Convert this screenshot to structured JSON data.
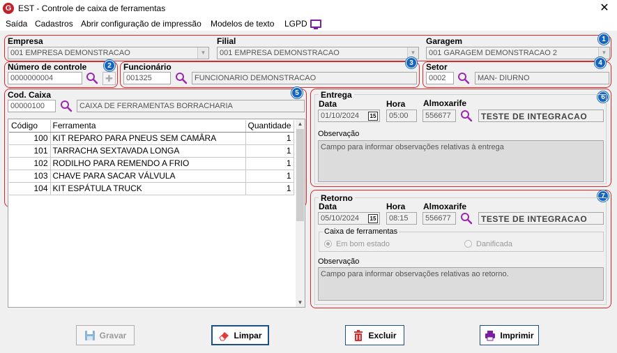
{
  "window": {
    "app_icon": "G",
    "title": "EST - Controle de caixa de ferramentas",
    "close_glyph": "✕"
  },
  "menu": [
    "Saída",
    "Cadastros",
    "Abrir configuração de impressão",
    "Modelos de texto",
    "LGPD"
  ],
  "header": {
    "empresa_label": "Empresa",
    "empresa_value": "001 EMPRESA DEMONSTRACAO",
    "filial_label": "Filial",
    "filial_value": "001 EMPRESA DEMONSTRACAO",
    "garagem_label": "Garagem",
    "garagem_value": "001 GARAGEM DEMONSTRACAO 2",
    "numero_label": "Número de controle",
    "numero_value": "0000000004",
    "funcionario_label": "Funcionário",
    "funcionario_code": "001325",
    "funcionario_name": "FUNCIONARIO DEMONSTRACAO",
    "setor_label": "Setor",
    "setor_code": "0002",
    "setor_name": "MAN- DIURNO"
  },
  "badges": [
    "1",
    "2",
    "3",
    "4",
    "5",
    "6",
    "7"
  ],
  "caixa": {
    "label": "Cod. Caixa",
    "code": "00000100",
    "name": "CAIXA DE FERRAMENTAS BORRACHARIA",
    "columns": [
      "Código",
      "Ferramenta",
      "Quantidade"
    ],
    "rows": [
      {
        "codigo": "100",
        "ferramenta": "KIT REPARO PARA PNEUS SEM CAMÂRA",
        "quantidade": "1"
      },
      {
        "codigo": "101",
        "ferramenta": "TARRACHA SEXTAVADA LONGA",
        "quantidade": "1"
      },
      {
        "codigo": "102",
        "ferramenta": "RODILHO PARA REMENDO A FRIO",
        "quantidade": "1"
      },
      {
        "codigo": "103",
        "ferramenta": "CHAVE PARA SACAR VÁLVULA",
        "quantidade": "1"
      },
      {
        "codigo": "104",
        "ferramenta": "KIT ESPÁTULA TRUCK",
        "quantidade": "1"
      }
    ]
  },
  "entrega": {
    "title": "Entrega",
    "data_label": "Data",
    "data_value": "01/10/2024",
    "calendar_glyph": "15",
    "hora_label": "Hora",
    "hora_value": "05:00",
    "almox_label": "Almoxarife",
    "almox_code": "556677",
    "almox_name": "TESTE DE INTEGRACAO",
    "obs_label": "Observação",
    "obs_value": "Campo para informar observações relativas à entrega"
  },
  "retorno": {
    "title": "Retorno",
    "data_label": "Data",
    "data_value": "05/10/2024",
    "calendar_glyph": "15",
    "hora_label": "Hora",
    "hora_value": "08:15",
    "almox_label": "Almoxarife",
    "almox_code": "556677",
    "almox_name": "TESTE DE INTEGRACAO",
    "caixa_group_label": "Caixa de ferramentas",
    "opt_bom": "Em bom estado",
    "opt_danificada": "Danificada",
    "obs_label": "Observação",
    "obs_value": "Campo para informar observações relativas ao retorno."
  },
  "buttons": {
    "gravar": "Gravar",
    "limpar": "Limpar",
    "excluir": "Excluir",
    "imprimir": "Imprimir"
  },
  "colors": {
    "accent_red": "#e02626",
    "badge_blue": "#1565c0",
    "search_purple": "#9c27b0"
  }
}
